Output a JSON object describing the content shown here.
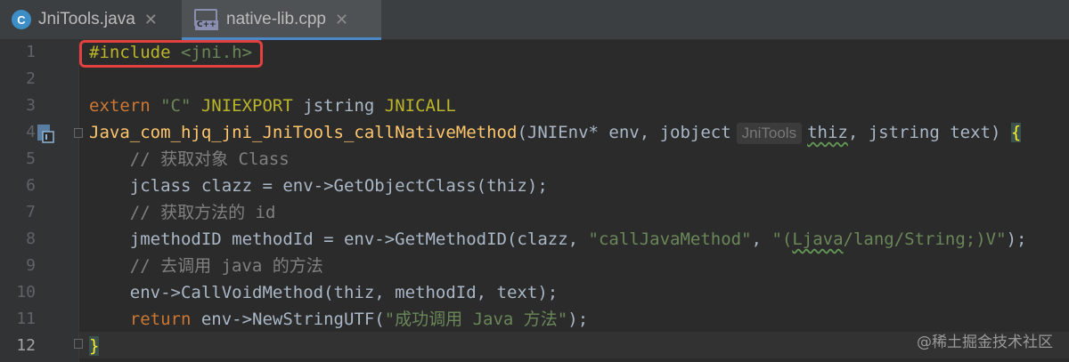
{
  "tabs": [
    {
      "label": "JniTools.java",
      "icon": "java-class-icon",
      "icon_text": "C"
    },
    {
      "label": "native-lib.cpp",
      "icon": "cpp-file-icon",
      "icon_text": "C++",
      "active": true
    }
  ],
  "editor": {
    "line_numbers": [
      "1",
      "2",
      "3",
      "4",
      "5",
      "6",
      "7",
      "8",
      "9",
      "10",
      "11",
      "12"
    ],
    "current_line": "12",
    "code": {
      "l1_directive": "#include",
      "l1_header": "<jni.h>",
      "l3_extern": "extern ",
      "l3_c": "\"C\"",
      "l3_export": "JNIEXPORT",
      "l3_type": " jstring ",
      "l3_call": "JNICALL",
      "l4_fn": "Java_com_hjq_jni_JniTools_callNativeMethod",
      "l4_params_a": "(JNIEnv* env, jobject",
      "l4_hint": "JniTools",
      "l4_thiz": "thiz",
      "l4_params_b": ", jstring text) ",
      "l4_brace": "{",
      "l5_comment": "    // 获取对象 Class",
      "l6_code": "    jclass clazz = env->GetObjectClass(thiz);",
      "l7_comment": "    // 获取方法的 id",
      "l8_a": "    jmethodID methodId = env->GetMethodID(clazz, ",
      "l8_s1": "\"callJavaMethod\"",
      "l8_b": ", ",
      "l8_s2a": "\"(",
      "l8_s2b": "Ljava",
      "l8_s2c": "/lang/String;)V\"",
      "l8_c": ");",
      "l9_comment": "    // 去调用 java 的方法",
      "l10_code": "    env->CallVoidMethod(thiz, methodId, text);",
      "l11_ret": "    return",
      "l11_a": " env->NewStringUTF(",
      "l11_s": "\"成功调用 Java 方法\"",
      "l11_b": ");",
      "l12_brace": "}"
    }
  },
  "watermark": "@稀土掘金技术社区",
  "colors": {
    "background": "#2b2b2b",
    "keyword": "#cc7832",
    "string": "#6a8759",
    "comment": "#808080",
    "function": "#ffc66d",
    "macro": "#bbb529",
    "highlight_box": "#e2413f"
  }
}
